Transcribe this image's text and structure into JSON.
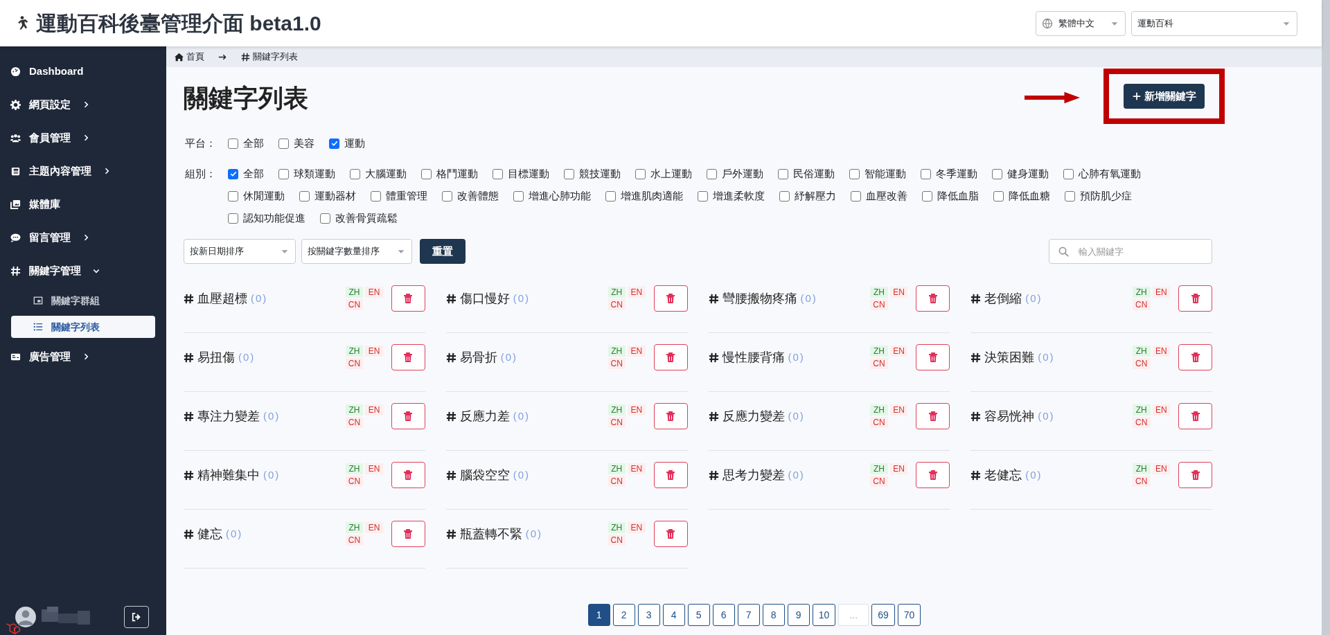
{
  "header": {
    "title": "運動百科後臺管理介面 beta1.0",
    "language_select": "繁體中文",
    "site_select": "運動百科"
  },
  "sidebar": {
    "items": [
      {
        "label": "Dashboard",
        "kind": "link"
      },
      {
        "label": "網頁設定",
        "kind": "menu",
        "expanded": false
      },
      {
        "label": "會員管理",
        "kind": "menu",
        "expanded": false
      },
      {
        "label": "主題內容管理",
        "kind": "menu",
        "expanded": false
      },
      {
        "label": "媒體庫",
        "kind": "link"
      },
      {
        "label": "留言管理",
        "kind": "menu",
        "expanded": false
      },
      {
        "label": "關鍵字管理",
        "kind": "menu",
        "expanded": true,
        "children": [
          {
            "label": "關鍵字群組",
            "selected": false
          },
          {
            "label": "關鍵字列表",
            "selected": true
          }
        ]
      },
      {
        "label": "廣告管理",
        "kind": "menu",
        "expanded": false
      }
    ]
  },
  "breadcrumb": [
    "首頁",
    "關鍵字列表"
  ],
  "page_title": "關鍵字列表",
  "add_button": "新增關鍵字",
  "filters": [
    {
      "label": "平台：",
      "options": [
        {
          "label": "全部",
          "checked": false
        },
        {
          "label": "美容",
          "checked": false
        },
        {
          "label": "運動",
          "checked": true
        }
      ]
    },
    {
      "label": "組別：",
      "options": [
        {
          "label": "全部",
          "checked": true
        },
        {
          "label": "球類運動",
          "checked": false
        },
        {
          "label": "大腦運動",
          "checked": false
        },
        {
          "label": "格鬥運動",
          "checked": false
        },
        {
          "label": "目標運動",
          "checked": false
        },
        {
          "label": "競技運動",
          "checked": false
        },
        {
          "label": "水上運動",
          "checked": false
        },
        {
          "label": "戶外運動",
          "checked": false
        },
        {
          "label": "民俗運動",
          "checked": false
        },
        {
          "label": "智能運動",
          "checked": false
        },
        {
          "label": "冬季運動",
          "checked": false
        },
        {
          "label": "健身運動",
          "checked": false
        },
        {
          "label": "心肺有氧運動",
          "checked": false
        },
        {
          "label": "休閒運動",
          "checked": false
        },
        {
          "label": "運動器材",
          "checked": false
        },
        {
          "label": "體重管理",
          "checked": false
        },
        {
          "label": "改善體態",
          "checked": false
        },
        {
          "label": "增進心肺功能",
          "checked": false
        },
        {
          "label": "增進肌肉適能",
          "checked": false
        },
        {
          "label": "增進柔軟度",
          "checked": false
        },
        {
          "label": "紓解壓力",
          "checked": false
        },
        {
          "label": "血壓改善",
          "checked": false
        },
        {
          "label": "降低血脂",
          "checked": false
        },
        {
          "label": "降低血糖",
          "checked": false
        },
        {
          "label": "預防肌少症",
          "checked": false
        },
        {
          "label": "認知功能促進",
          "checked": false
        },
        {
          "label": "改善骨質疏鬆",
          "checked": false
        }
      ]
    }
  ],
  "sort_selects": [
    "按新日期排序",
    "按關鍵字數量排序"
  ],
  "reset_button": "重置",
  "search": {
    "placeholder": "輸入關鍵字"
  },
  "keywords": [
    {
      "name": "血壓超標",
      "count": "(0)",
      "langs": [
        {
          "label": "ZH",
          "done": true
        },
        {
          "label": "EN",
          "done": false
        },
        {
          "label": "CN",
          "done": false
        }
      ]
    },
    {
      "name": "傷口慢好",
      "count": "(0)",
      "langs": [
        {
          "label": "ZH",
          "done": true
        },
        {
          "label": "EN",
          "done": false
        },
        {
          "label": "CN",
          "done": false
        }
      ]
    },
    {
      "name": "彎腰搬物疼痛",
      "count": "(0)",
      "langs": [
        {
          "label": "ZH",
          "done": true
        },
        {
          "label": "EN",
          "done": false
        },
        {
          "label": "CN",
          "done": false
        }
      ]
    },
    {
      "name": "老倒縮",
      "count": "(0)",
      "langs": [
        {
          "label": "ZH",
          "done": true
        },
        {
          "label": "EN",
          "done": false
        },
        {
          "label": "CN",
          "done": false
        }
      ]
    },
    {
      "name": "易扭傷",
      "count": "(0)",
      "langs": [
        {
          "label": "ZH",
          "done": true
        },
        {
          "label": "EN",
          "done": false
        },
        {
          "label": "CN",
          "done": false
        }
      ]
    },
    {
      "name": "易骨折",
      "count": "(0)",
      "langs": [
        {
          "label": "ZH",
          "done": true
        },
        {
          "label": "EN",
          "done": false
        },
        {
          "label": "CN",
          "done": false
        }
      ]
    },
    {
      "name": "慢性腰背痛",
      "count": "(0)",
      "langs": [
        {
          "label": "ZH",
          "done": true
        },
        {
          "label": "EN",
          "done": false
        },
        {
          "label": "CN",
          "done": false
        }
      ]
    },
    {
      "name": "決策困難",
      "count": "(0)",
      "langs": [
        {
          "label": "ZH",
          "done": true
        },
        {
          "label": "EN",
          "done": false
        },
        {
          "label": "CN",
          "done": false
        }
      ]
    },
    {
      "name": "專注力變差",
      "count": "(0)",
      "langs": [
        {
          "label": "ZH",
          "done": true
        },
        {
          "label": "EN",
          "done": false
        },
        {
          "label": "CN",
          "done": false
        }
      ]
    },
    {
      "name": "反應力差",
      "count": "(0)",
      "langs": [
        {
          "label": "ZH",
          "done": true
        },
        {
          "label": "EN",
          "done": false
        },
        {
          "label": "CN",
          "done": false
        }
      ]
    },
    {
      "name": "反應力變差",
      "count": "(0)",
      "langs": [
        {
          "label": "ZH",
          "done": true
        },
        {
          "label": "EN",
          "done": false
        },
        {
          "label": "CN",
          "done": false
        }
      ]
    },
    {
      "name": "容易恍神",
      "count": "(0)",
      "langs": [
        {
          "label": "ZH",
          "done": true
        },
        {
          "label": "EN",
          "done": false
        },
        {
          "label": "CN",
          "done": false
        }
      ]
    },
    {
      "name": "精神難集中",
      "count": "(0)",
      "langs": [
        {
          "label": "ZH",
          "done": true
        },
        {
          "label": "EN",
          "done": false
        },
        {
          "label": "CN",
          "done": false
        }
      ]
    },
    {
      "name": "腦袋空空",
      "count": "(0)",
      "langs": [
        {
          "label": "ZH",
          "done": true
        },
        {
          "label": "EN",
          "done": false
        },
        {
          "label": "CN",
          "done": false
        }
      ]
    },
    {
      "name": "思考力變差",
      "count": "(0)",
      "langs": [
        {
          "label": "ZH",
          "done": true
        },
        {
          "label": "EN",
          "done": false
        },
        {
          "label": "CN",
          "done": false
        }
      ]
    },
    {
      "name": "老健忘",
      "count": "(0)",
      "langs": [
        {
          "label": "ZH",
          "done": true
        },
        {
          "label": "EN",
          "done": false
        },
        {
          "label": "CN",
          "done": false
        }
      ]
    },
    {
      "name": "健忘",
      "count": "(0)",
      "langs": [
        {
          "label": "ZH",
          "done": true
        },
        {
          "label": "EN",
          "done": false
        },
        {
          "label": "CN",
          "done": false
        }
      ]
    },
    {
      "name": "瓶蓋轉不緊",
      "count": "(0)",
      "langs": [
        {
          "label": "ZH",
          "done": true
        },
        {
          "label": "EN",
          "done": false
        },
        {
          "label": "CN",
          "done": false
        }
      ]
    }
  ],
  "pagination": [
    {
      "label": "1",
      "selected": true,
      "disabled": false
    },
    {
      "label": "2",
      "selected": false,
      "disabled": false
    },
    {
      "label": "3",
      "selected": false,
      "disabled": false
    },
    {
      "label": "4",
      "selected": false,
      "disabled": false
    },
    {
      "label": "5",
      "selected": false,
      "disabled": false
    },
    {
      "label": "6",
      "selected": false,
      "disabled": false
    },
    {
      "label": "7",
      "selected": false,
      "disabled": false
    },
    {
      "label": "8",
      "selected": false,
      "disabled": false
    },
    {
      "label": "9",
      "selected": false,
      "disabled": false
    },
    {
      "label": "10",
      "selected": false,
      "disabled": false
    },
    {
      "label": "...",
      "selected": false,
      "disabled": true
    },
    {
      "label": "69",
      "selected": false,
      "disabled": false
    },
    {
      "label": "70",
      "selected": false,
      "disabled": false
    }
  ]
}
